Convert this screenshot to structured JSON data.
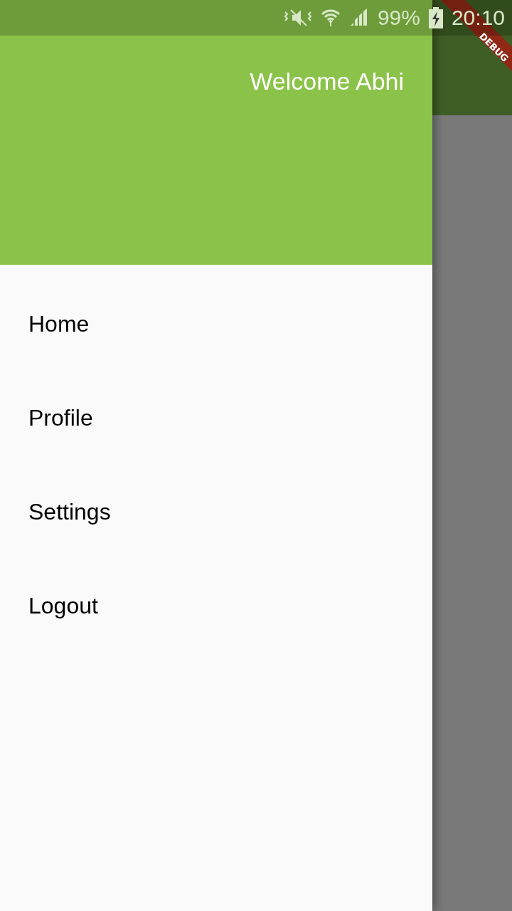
{
  "status_bar": {
    "battery": "99%",
    "time": "20:10"
  },
  "drawer": {
    "header": {
      "title": "Welcome Abhi"
    },
    "items": [
      {
        "label": "Home"
      },
      {
        "label": "Profile"
      },
      {
        "label": "Settings"
      },
      {
        "label": "Logout"
      }
    ]
  },
  "debug_banner": "DEBUG"
}
